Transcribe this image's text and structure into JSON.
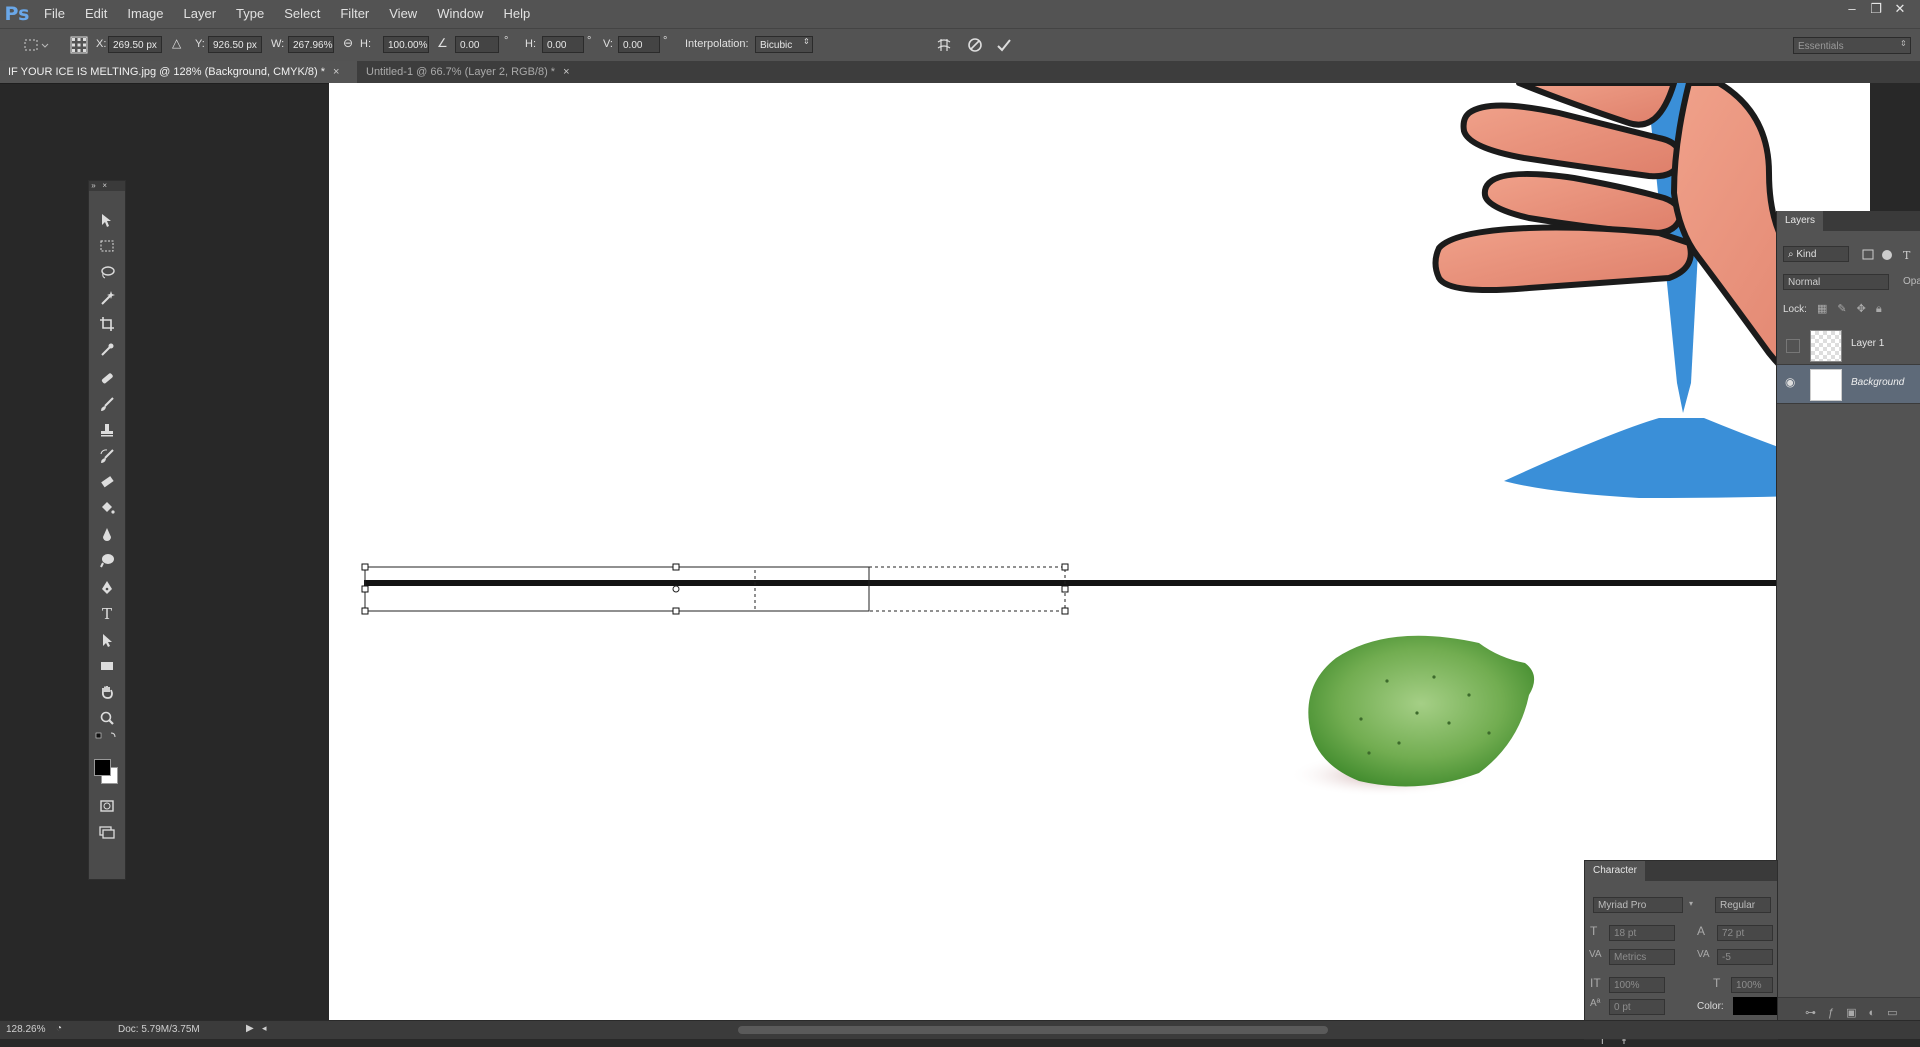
{
  "app": {
    "logo": "Ps"
  },
  "menu": [
    "File",
    "Edit",
    "Image",
    "Layer",
    "Type",
    "Select",
    "Filter",
    "View",
    "Window",
    "Help"
  ],
  "window_controls": {
    "minimize": "–",
    "restore": "❐",
    "close": "✕"
  },
  "options": {
    "x_label": "X:",
    "x_value": "269.50 px",
    "y_label": "Y:",
    "y_value": "926.50 px",
    "w_label": "W:",
    "w_value": "267.96%",
    "h_label": "H:",
    "h_value": "100.00%",
    "angle_value": "0.00",
    "degree": "°",
    "hskew_label": "H:",
    "hskew_value": "0.00",
    "vskew_label": "V:",
    "vskew_value": "0.00",
    "interp_label": "Interpolation:",
    "interp_value": "Bicubic",
    "workspace": "Essentials"
  },
  "tabs": [
    {
      "label": "IF YOUR ICE IS MELTING.jpg @ 128% (Background, CMYK/8) *",
      "active": true
    },
    {
      "label": "Untitled-1 @ 66.7% (Layer 2, RGB/8) *",
      "active": false
    }
  ],
  "layers_panel": {
    "title": "Layers",
    "kind_label": "Kind",
    "blend_mode": "Normal",
    "opacity_label": "Opac",
    "lock_label": "Lock:",
    "layers": [
      {
        "name": "Layer 1",
        "visible": false
      },
      {
        "name": "Background",
        "visible": true,
        "selected": true
      }
    ]
  },
  "character_panel": {
    "title": "Character",
    "font_family": "Myriad Pro",
    "font_style": "Regular",
    "size": "18 pt",
    "leading": "72 pt",
    "kerning": "Metrics",
    "tracking": "-5",
    "vscale": "100%",
    "hscale": "100%",
    "baseline": "0 pt",
    "color_label": "Color:"
  },
  "status": {
    "zoom": "128.26%",
    "doc": "Doc: 5.79M/3.75M"
  },
  "colors": {
    "foreground": "#000000",
    "background": "#ffffff",
    "accent_blue": "#3a8fd8",
    "hand": "#e8907a",
    "lime": "#6aa94a"
  }
}
